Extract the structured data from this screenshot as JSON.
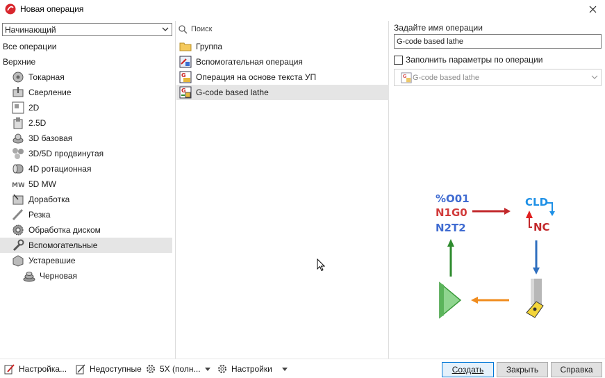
{
  "window": {
    "title": "Новая операция"
  },
  "left": {
    "level_value": "Начинающий",
    "all_ops": "Все операции",
    "top": "Верхние",
    "items": [
      {
        "label": "Токарная",
        "icon": "lathe-icon"
      },
      {
        "label": "Сверление",
        "icon": "drill-icon"
      },
      {
        "label": "2D",
        "icon": "2d-icon"
      },
      {
        "label": "2.5D",
        "icon": "2-5d-icon"
      },
      {
        "label": "3D базовая",
        "icon": "3d-basic-icon"
      },
      {
        "label": "3D/5D продвинутая",
        "icon": "3d-5d-advanced-icon"
      },
      {
        "label": "4D ротационная",
        "icon": "4d-rotary-icon"
      },
      {
        "label": "5D MW",
        "icon": "5d-mw-icon"
      },
      {
        "label": "Доработка",
        "icon": "rework-icon"
      },
      {
        "label": "Резка",
        "icon": "cutting-icon"
      },
      {
        "label": "Обработка диском",
        "icon": "disk-machining-icon"
      },
      {
        "label": "Вспомогательные",
        "icon": "wrench-icon"
      },
      {
        "label": "Устаревшие",
        "icon": "obsolete-icon"
      }
    ],
    "sub_items": [
      {
        "label": "Черновая",
        "icon": "roughing-icon"
      }
    ],
    "selected_index": 11
  },
  "mid": {
    "search_placeholder": "Поиск",
    "items": [
      {
        "label": "Группа",
        "icon": "folder-icon"
      },
      {
        "label": "Вспомогательная операция",
        "icon": "aux-operation-icon"
      },
      {
        "label": "Операция на основе текста УП",
        "icon": "nc-text-operation-icon"
      },
      {
        "label": "G-code based lathe",
        "icon": "gcode-lathe-icon"
      }
    ],
    "selected_index": 3
  },
  "right": {
    "name_label": "Задайте имя операции",
    "name_value": "G-code based lathe",
    "fill_label": "Заполнить параметры по операции",
    "fill_checked": false,
    "dropdown_value": "G-code based lathe",
    "diagram": {
      "line1": "%O01",
      "line2": "N1G0",
      "line3": "N2T2",
      "cld": "CLD",
      "nc": "NC"
    }
  },
  "bottom": {
    "settings_label": "Настройка...",
    "unavailable_label": "Недоступные",
    "axes_label": "5X (полн...",
    "prefs_label": "Настройки",
    "create_label": "Создать",
    "close_label": "Закрыть",
    "help_label": "Справка"
  },
  "colors": {
    "accent": "#0078d7",
    "selection": "#e5e5e5",
    "code_blue": "#3f6bd1",
    "code_red": "#d13b3b",
    "arrow_green": "#2e8b2e",
    "arrow_orange": "#f08c1e",
    "cld_blue": "#1e90e6"
  }
}
